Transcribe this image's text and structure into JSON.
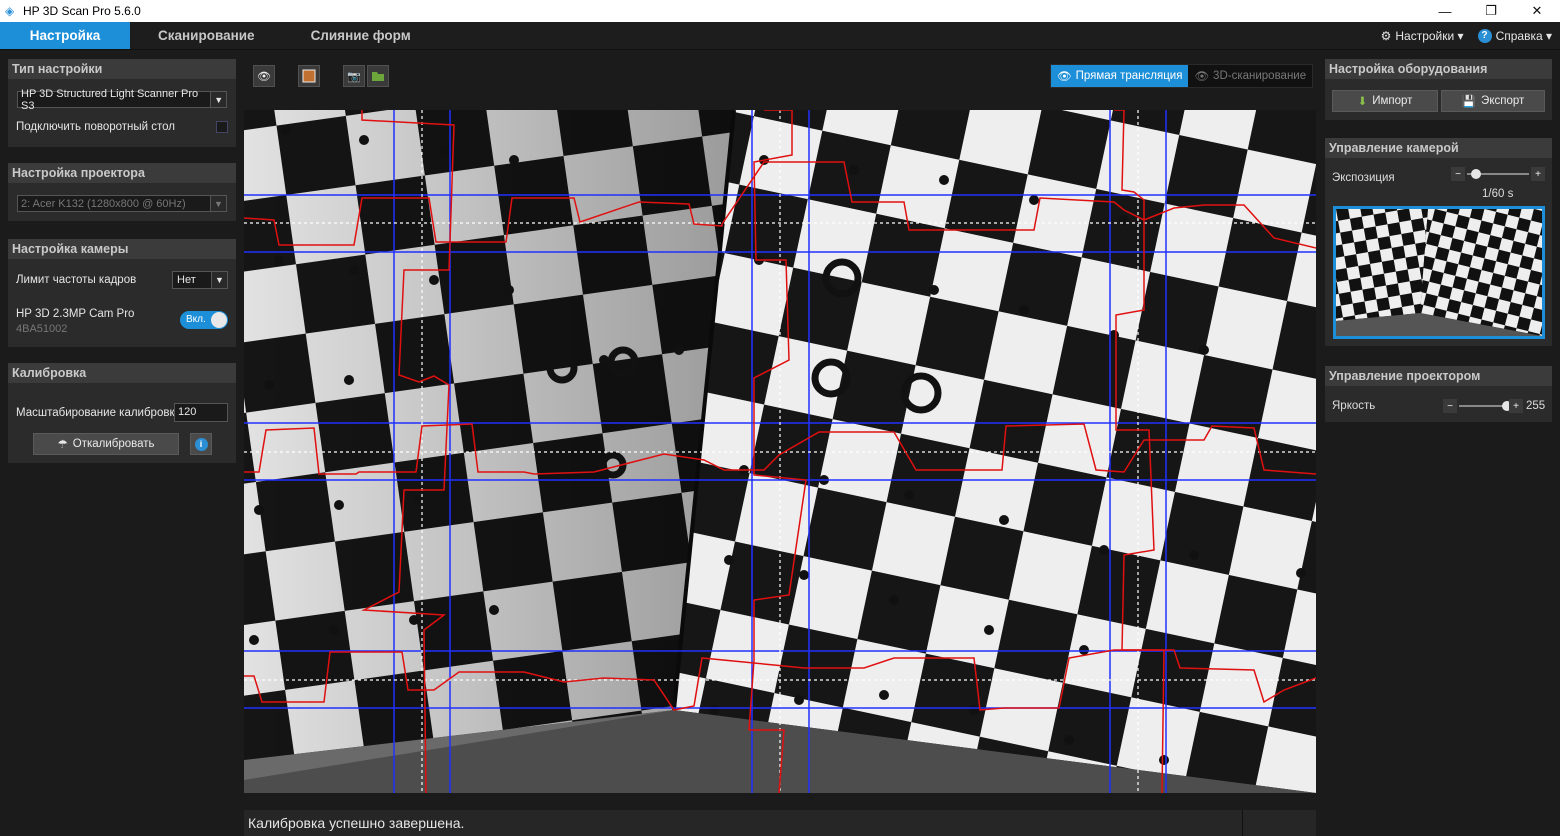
{
  "window": {
    "title": "HP 3D Scan Pro 5.6.0"
  },
  "menu": {
    "tabs": [
      "Настройка",
      "Сканирование",
      "Слияние форм"
    ],
    "settings_label": "Настройки ▾",
    "help_label": "Справка ▾"
  },
  "setup_type": {
    "header": "Тип настройки",
    "scanner_value": "HP 3D Structured Light Scanner Pro S3",
    "turntable_label": "Подключить поворотный стол"
  },
  "projector_setup": {
    "header": "Настройка проектора",
    "projector_value": "2: Acer K132 (1280x800 @ 60Hz)"
  },
  "camera_setup": {
    "header": "Настройка камеры",
    "framerate_label": "Лимит частоты кадров",
    "framerate_value": "Нет",
    "camera_name": "HP 3D 2.3MP Cam Pro",
    "camera_serial": "4BA51002",
    "camera_toggle": "Вкл."
  },
  "calibration": {
    "header": "Калибровка",
    "scale_label": "Масштабирование калибровки",
    "scale_value": "120",
    "calibrate_label": "Откалибровать"
  },
  "view_modes": {
    "live": "Прямая трансляция",
    "scan3d": "3D-сканирование"
  },
  "status": {
    "message": "Калибровка успешно завершена."
  },
  "hardware": {
    "header": "Настройка оборудования",
    "import_label": "Импорт",
    "export_label": "Экспорт"
  },
  "camera_control": {
    "header": "Управление камерой",
    "exposure_label": "Экспозиция",
    "exposure_value": "1/60 s",
    "exposure_level": 0.15
  },
  "projector_control": {
    "header": "Управление проектором",
    "brightness_label": "Яркость",
    "brightness_value": "255",
    "brightness_level": 1.0
  },
  "colors": {
    "accent": "#1d8fd8",
    "overlay_red": "#e01010",
    "overlay_blue": "#2030ff"
  }
}
